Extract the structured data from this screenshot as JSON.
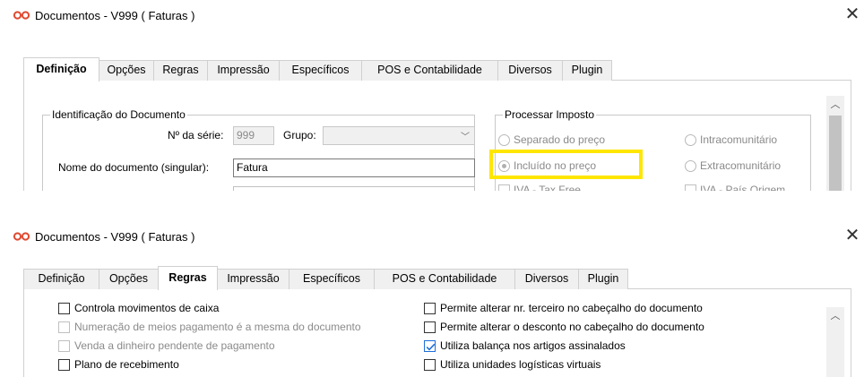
{
  "colors": {
    "highlight": "#ffe600",
    "app_icon": "#e0482f",
    "check_accent": "#1e6fd9"
  },
  "windows": [
    {
      "icon": "infinity-icon",
      "title": "Documentos - V999 ( Faturas )",
      "close_icon": "close-icon",
      "tabs": [
        {
          "label": "Definição",
          "active": true
        },
        {
          "label": "Opções",
          "active": false
        },
        {
          "label": "Regras",
          "active": false
        },
        {
          "label": "Impressão",
          "active": false
        },
        {
          "label": "Específicos",
          "active": false
        },
        {
          "label": "POS e Contabilidade",
          "active": false
        },
        {
          "label": "Diversos",
          "active": false
        },
        {
          "label": "Plugin",
          "active": false
        }
      ],
      "identificacao": {
        "legend": "Identificação do Documento",
        "serie_label": "Nº da série:",
        "serie_value": "999",
        "grupo_label": "Grupo:",
        "grupo_value": "",
        "nome_label": "Nome do documento (singular):",
        "nome_value": "Fatura"
      },
      "imposto": {
        "legend": "Processar Imposto",
        "options": [
          {
            "label": "Separado do preço",
            "checked": false
          },
          {
            "label": "Intracomunitário",
            "checked": false
          },
          {
            "label": "Incluído no preço",
            "checked": true
          },
          {
            "label": "Extracomunitário",
            "checked": false
          },
          {
            "label": "IVA - Tax Free",
            "checked": false
          },
          {
            "label": "IVA - País Origem",
            "checked": false
          }
        ]
      }
    },
    {
      "icon": "infinity-icon",
      "title": "Documentos - V999 ( Faturas )",
      "close_icon": "close-icon",
      "tabs": [
        {
          "label": "Definição",
          "active": false
        },
        {
          "label": "Opções",
          "active": false
        },
        {
          "label": "Regras",
          "active": true
        },
        {
          "label": "Impressão",
          "active": false
        },
        {
          "label": "Específicos",
          "active": false
        },
        {
          "label": "POS e Contabilidade",
          "active": false
        },
        {
          "label": "Diversos",
          "active": false
        },
        {
          "label": "Plugin",
          "active": false
        }
      ],
      "rules_left": [
        {
          "label": "Controla movimentos de caixa",
          "checked": false,
          "enabled": true
        },
        {
          "label": "Numeração de meios pagamento é a mesma do documento",
          "checked": false,
          "enabled": false
        },
        {
          "label": "Venda a dinheiro pendente de pagamento",
          "checked": false,
          "enabled": false
        },
        {
          "label": "Plano de recebimento",
          "checked": false,
          "enabled": true
        }
      ],
      "rules_right": [
        {
          "label": "Permite alterar nr. terceiro  no cabeçalho do documento",
          "checked": false,
          "enabled": true
        },
        {
          "label": "Permite alterar o desconto no cabeçalho do documento",
          "checked": false,
          "enabled": true
        },
        {
          "label": "Utiliza balança nos artigos assinalados",
          "checked": true,
          "enabled": true
        },
        {
          "label": "Utiliza unidades logísticas virtuais",
          "checked": false,
          "enabled": true
        }
      ]
    }
  ]
}
